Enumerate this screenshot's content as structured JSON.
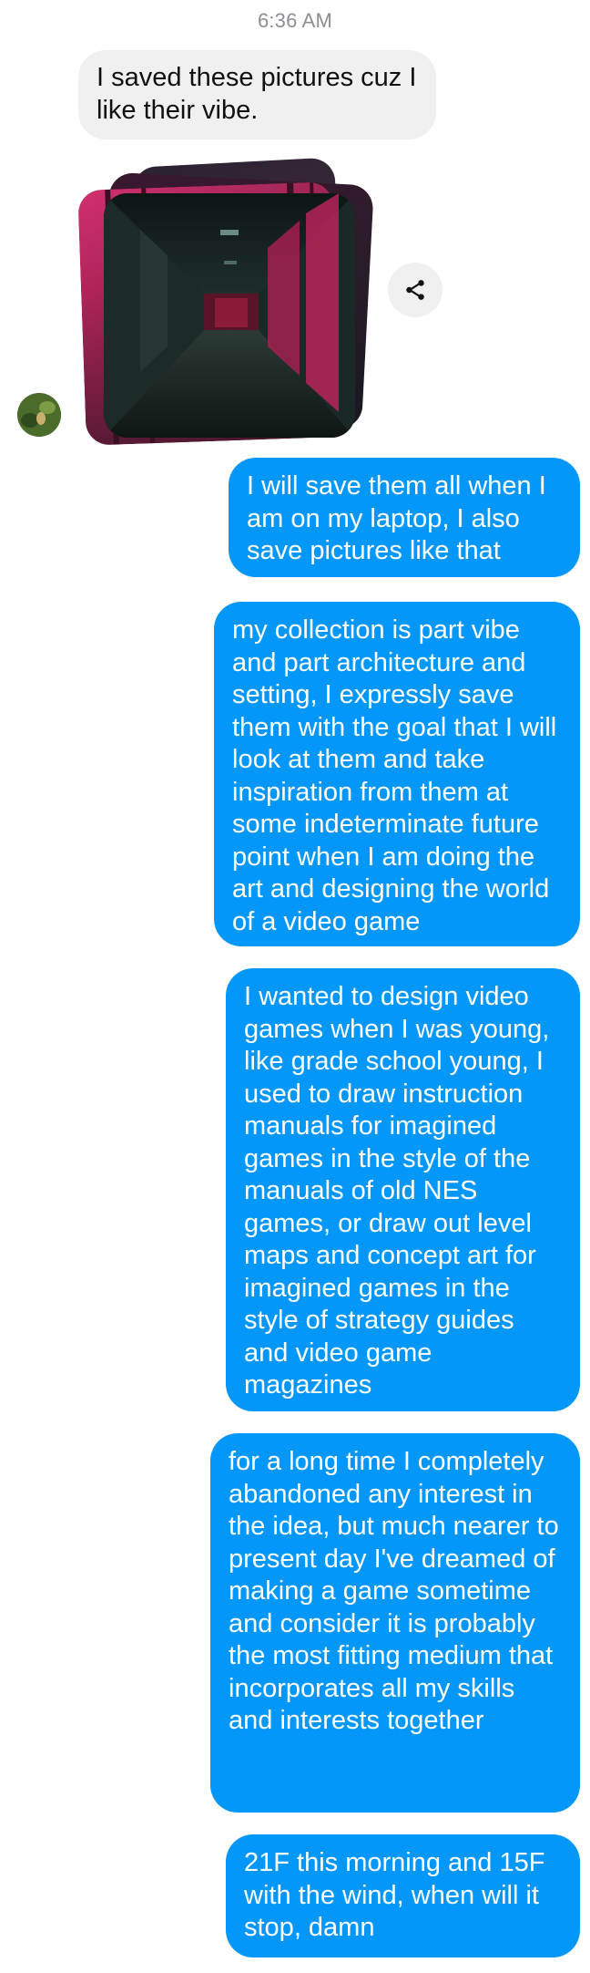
{
  "timestamp": "6:36 AM",
  "incoming": {
    "text": "I saved these pictures cuz I like their vibe."
  },
  "attachment": {
    "share_icon": "share-icon",
    "avatar_icon": "avatar"
  },
  "outgoing": [
    {
      "text": "I will save them all when I am on my laptop, I also save pictures like that"
    },
    {
      "text": "my collection is part vibe and part architecture and setting, I expressly save them with the goal that I will look at them and take inspiration from them at some indeterminate future point when I am doing the art and designing the world of a video game"
    },
    {
      "text": "I wanted to design video games when I was young, like grade school young, I used to draw instruction manuals for imagined games in the style of the manuals of old NES games, or draw out level maps and concept art for imagined games in the style of strategy guides and video game magazines"
    },
    {
      "text": "for a long time I completely abandoned any interest in the idea, but much nearer to present day I've dreamed of making a game sometime and consider it is probably the most fitting medium that incorporates all my skills and interests together"
    },
    {
      "text": "21F this morning and 15F with the wind, when will it stop, damn"
    }
  ],
  "colors": {
    "outgoing_bubble": "#0497fa",
    "incoming_bubble": "#f0f0f0",
    "timestamp": "#8e8e93"
  }
}
